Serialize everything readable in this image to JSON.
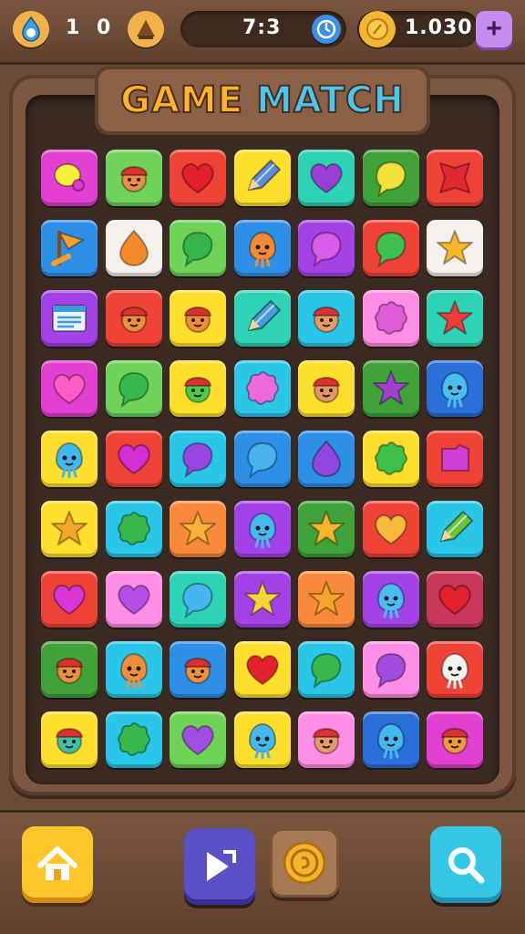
{
  "hud": {
    "lives": "1",
    "score": "0",
    "timer": "7:3",
    "coins": "1.030"
  },
  "title": {
    "word1": "GAME",
    "word2": "MATCH"
  },
  "colors": {
    "magenta": "#e23fd3",
    "green": "#6fd35a",
    "red": "#ef4338",
    "yellow": "#ffdf2e",
    "teal": "#2ed3b5",
    "blue": "#2d8fe6",
    "white": "#f4f1ec",
    "purple": "#a442e8",
    "pink": "#ff8fe4",
    "orange": "#f98a3c",
    "cyan": "#2ac6e8",
    "darkgreen": "#3fa33a",
    "darkblue": "#2a6ed9",
    "maroon": "#c8365a"
  },
  "grid": [
    [
      {
        "bg": "magenta",
        "icon": "blob",
        "fg": "#f2f13a"
      },
      {
        "bg": "green",
        "icon": "face",
        "fg": "#e98e4a"
      },
      {
        "bg": "red",
        "icon": "heart",
        "fg": "#e21f2a"
      },
      {
        "bg": "yellow",
        "icon": "pencil",
        "fg": "#5b8ddc"
      },
      {
        "bg": "teal",
        "icon": "heart",
        "fg": "#9a3fd6"
      },
      {
        "bg": "darkgreen",
        "icon": "bubble",
        "fg": "#f4e13a"
      },
      {
        "bg": "red",
        "icon": "star4",
        "fg": "#e0262e"
      }
    ],
    [
      {
        "bg": "blue",
        "icon": "flag",
        "fg": "#f4a22c"
      },
      {
        "bg": "white",
        "icon": "drop",
        "fg": "#f48a2a"
      },
      {
        "bg": "green",
        "icon": "bubble",
        "fg": "#36b548"
      },
      {
        "bg": "blue",
        "icon": "ghost",
        "fg": "#f08a36"
      },
      {
        "bg": "purple",
        "icon": "bubble",
        "fg": "#d75ce8"
      },
      {
        "bg": "red",
        "icon": "bubble",
        "fg": "#3fc04e"
      },
      {
        "bg": "white",
        "icon": "star",
        "fg": "#f7b52a"
      }
    ],
    [
      {
        "bg": "purple",
        "icon": "doc",
        "fg": "#3f9bd8"
      },
      {
        "bg": "red",
        "icon": "face",
        "fg": "#f08e3e"
      },
      {
        "bg": "yellow",
        "icon": "face",
        "fg": "#f08e3e"
      },
      {
        "bg": "teal",
        "icon": "pencil",
        "fg": "#4a9bd9"
      },
      {
        "bg": "cyan",
        "icon": "face",
        "fg": "#e99a62"
      },
      {
        "bg": "pink",
        "icon": "splat",
        "fg": "#e05bd6"
      },
      {
        "bg": "teal",
        "icon": "star",
        "fg": "#ee3b3b"
      }
    ],
    [
      {
        "bg": "magenta",
        "icon": "heart",
        "fg": "#ff5cc4"
      },
      {
        "bg": "green",
        "icon": "bubble",
        "fg": "#38b84a"
      },
      {
        "bg": "yellow",
        "icon": "face",
        "fg": "#4ccb4a"
      },
      {
        "bg": "cyan",
        "icon": "splat",
        "fg": "#ec6ad8"
      },
      {
        "bg": "yellow",
        "icon": "face",
        "fg": "#e6956b"
      },
      {
        "bg": "darkgreen",
        "icon": "star",
        "fg": "#a23fd1"
      },
      {
        "bg": "darkblue",
        "icon": "ghost",
        "fg": "#49bff0"
      }
    ],
    [
      {
        "bg": "yellow",
        "icon": "ghost",
        "fg": "#42b8f0"
      },
      {
        "bg": "red",
        "icon": "heart",
        "fg": "#d42fd2"
      },
      {
        "bg": "cyan",
        "icon": "bubble",
        "fg": "#9b45e2"
      },
      {
        "bg": "blue",
        "icon": "bubble",
        "fg": "#47b4f0"
      },
      {
        "bg": "blue",
        "icon": "drop",
        "fg": "#9247e1"
      },
      {
        "bg": "yellow",
        "icon": "splat",
        "fg": "#3fbe4a"
      },
      {
        "bg": "red",
        "icon": "square",
        "fg": "#cf3fd6"
      }
    ],
    [
      {
        "bg": "yellow",
        "icon": "star",
        "fg": "#f2a82a"
      },
      {
        "bg": "cyan",
        "icon": "splat",
        "fg": "#38b84a"
      },
      {
        "bg": "orange",
        "icon": "star",
        "fg": "#f6b23a"
      },
      {
        "bg": "purple",
        "icon": "ghost",
        "fg": "#47b9ef"
      },
      {
        "bg": "darkgreen",
        "icon": "star",
        "fg": "#f6b52a"
      },
      {
        "bg": "red",
        "icon": "heart",
        "fg": "#f7b93a"
      },
      {
        "bg": "cyan",
        "icon": "pencil",
        "fg": "#6ec43a"
      }
    ],
    [
      {
        "bg": "red",
        "icon": "heart",
        "fg": "#d637d6"
      },
      {
        "bg": "pink",
        "icon": "heart",
        "fg": "#b44ee6"
      },
      {
        "bg": "teal",
        "icon": "bubble",
        "fg": "#45b6ef"
      },
      {
        "bg": "purple",
        "icon": "star",
        "fg": "#f7d53a"
      },
      {
        "bg": "orange",
        "icon": "star",
        "fg": "#f6a42c"
      },
      {
        "bg": "purple",
        "icon": "ghost",
        "fg": "#49bcf1"
      },
      {
        "bg": "maroon",
        "icon": "heart",
        "fg": "#e2212d"
      }
    ],
    [
      {
        "bg": "darkgreen",
        "icon": "face",
        "fg": "#f08e3e"
      },
      {
        "bg": "cyan",
        "icon": "ghost",
        "fg": "#f08e3e"
      },
      {
        "bg": "blue",
        "icon": "face",
        "fg": "#f08e3e"
      },
      {
        "bg": "yellow",
        "icon": "heart",
        "fg": "#e2212d"
      },
      {
        "bg": "cyan",
        "icon": "bubble",
        "fg": "#38b84a"
      },
      {
        "bg": "pink",
        "icon": "bubble",
        "fg": "#a34de0"
      },
      {
        "bg": "red",
        "icon": "ghost",
        "fg": "#f5f3ef"
      }
    ],
    [
      {
        "bg": "yellow",
        "icon": "face",
        "fg": "#3fc3a4"
      },
      {
        "bg": "cyan",
        "icon": "splat",
        "fg": "#38b84a"
      },
      {
        "bg": "green",
        "icon": "heart",
        "fg": "#a44de2"
      },
      {
        "bg": "yellow",
        "icon": "ghost",
        "fg": "#46b8f0"
      },
      {
        "bg": "pink",
        "icon": "face",
        "fg": "#e69a6c"
      },
      {
        "bg": "darkblue",
        "icon": "ghost",
        "fg": "#46b8f0"
      },
      {
        "bg": "magenta",
        "icon": "face",
        "fg": "#f09a3e"
      }
    ]
  ],
  "icons": {
    "lives": "drop-avatar-icon",
    "score": "trophy-icon",
    "timer": "clock-icon",
    "coins": "coin-icon",
    "add": "plus-icon",
    "home": "home-icon",
    "play": "play-skip-icon",
    "bonus": "coin-icon",
    "search": "search-icon"
  }
}
